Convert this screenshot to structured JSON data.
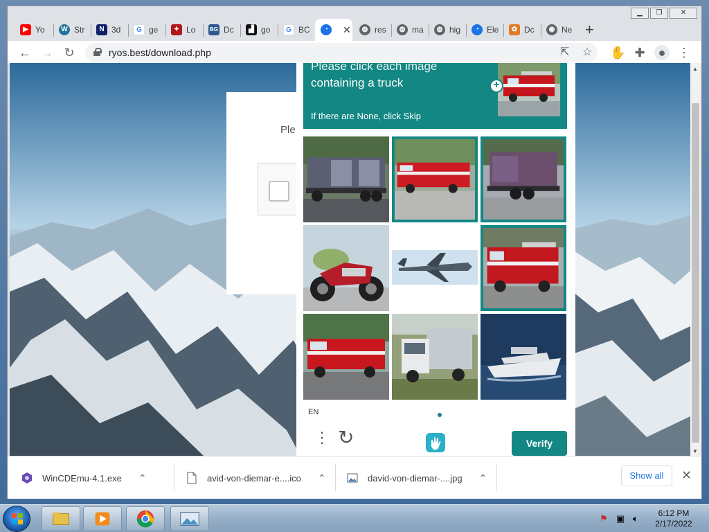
{
  "browser": {
    "tabs": [
      {
        "label": "Yo",
        "icon": "youtube-icon",
        "color": "#ff0000"
      },
      {
        "label": "Str",
        "icon": "wordpress-icon",
        "color": "#21759b"
      },
      {
        "label": "3d",
        "icon": "3d-site-icon",
        "color": "#10206b"
      },
      {
        "label": "ge",
        "icon": "google-icon",
        "color": "#4285f4"
      },
      {
        "label": "Lo",
        "icon": "lo-site-icon",
        "color": "#b2171b"
      },
      {
        "label": "Dc",
        "icon": "dc-site-icon",
        "color": "#2d5a8f"
      },
      {
        "label": "go",
        "icon": "go-site-icon",
        "color": "#111111"
      },
      {
        "label": "BC",
        "icon": "google-icon",
        "color": "#4285f4"
      },
      {
        "label": "",
        "icon": "active-site-icon",
        "color": "#1a73e8",
        "active": true
      },
      {
        "label": "res",
        "icon": "globe-icon",
        "color": "#5f6368"
      },
      {
        "label": "ma",
        "icon": "globe-icon",
        "color": "#5f6368"
      },
      {
        "label": "hig",
        "icon": "globe-icon",
        "color": "#5f6368"
      },
      {
        "label": "Ele",
        "icon": "active-site-icon",
        "color": "#1a73e8"
      },
      {
        "label": "Dc",
        "icon": "dc-orange-icon",
        "color": "#e07b28"
      },
      {
        "label": "Ne",
        "icon": "ne-site-icon",
        "color": "#5f6368"
      }
    ],
    "url": "ryos.best/download.php",
    "close_tab": "✕",
    "new_tab": "+"
  },
  "page": {
    "card_text": "Ple"
  },
  "captcha": {
    "prompt_line1": "Please click each image",
    "prompt_line2": "containing a truck",
    "skip_text": "If there are None, click Skip",
    "language": "EN",
    "verify_label": "Verify",
    "accent": "#138783",
    "tiles": [
      {
        "subject": "truck",
        "selected": false
      },
      {
        "subject": "fire-truck",
        "selected": true
      },
      {
        "subject": "truck",
        "selected": true
      },
      {
        "subject": "motorcycle",
        "selected": false
      },
      {
        "subject": "airplane",
        "selected": false
      },
      {
        "subject": "fire-truck",
        "selected": true
      },
      {
        "subject": "fire-truck",
        "selected": false
      },
      {
        "subject": "truck",
        "selected": false
      },
      {
        "subject": "boat",
        "selected": false
      }
    ]
  },
  "downloads": {
    "items": [
      {
        "name": "WinCDEmu-4.1.exe",
        "icon": "installer-icon"
      },
      {
        "name": "avid-von-diemar-e....ico",
        "icon": "file-icon"
      },
      {
        "name": "david-von-diemar-....jpg",
        "icon": "image-file-icon"
      }
    ],
    "show_all": "Show all",
    "close": "✕"
  },
  "taskbar": {
    "time": "6:12 PM",
    "date": "2/17/2022"
  }
}
